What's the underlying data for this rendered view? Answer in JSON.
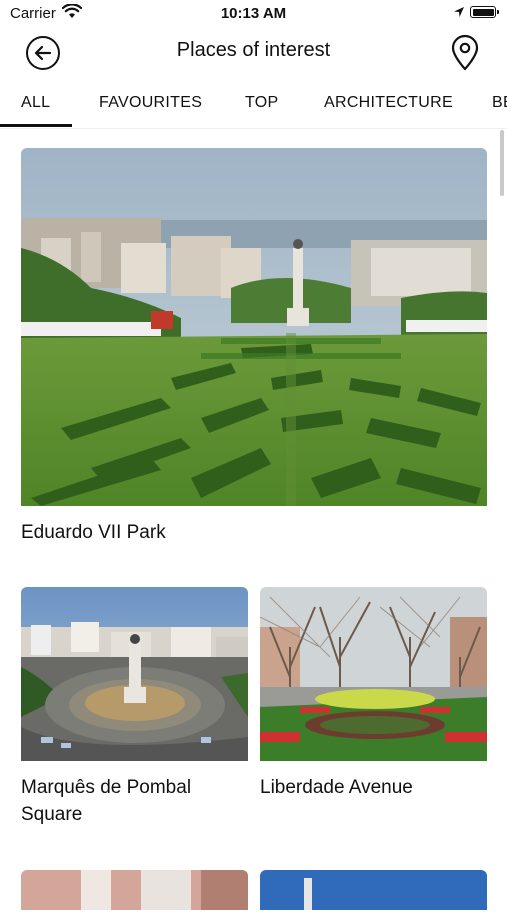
{
  "status_bar": {
    "carrier": "Carrier",
    "time": "10:13 AM"
  },
  "header": {
    "title": "Places of interest",
    "back_icon": "arrow-left-circle-icon",
    "map_icon": "map-pin-icon"
  },
  "tabs": [
    {
      "label": "ALL",
      "selected": true
    },
    {
      "label": "FAVOURITES",
      "selected": false
    },
    {
      "label": "TOP",
      "selected": false
    },
    {
      "label": "ARCHITECTURE",
      "selected": false
    },
    {
      "label": "BE",
      "selected": false
    }
  ],
  "places": [
    {
      "name": "Eduardo VII Park"
    },
    {
      "name": "Marquês de Pombal Square"
    },
    {
      "name": "Liberdade Avenue"
    }
  ]
}
